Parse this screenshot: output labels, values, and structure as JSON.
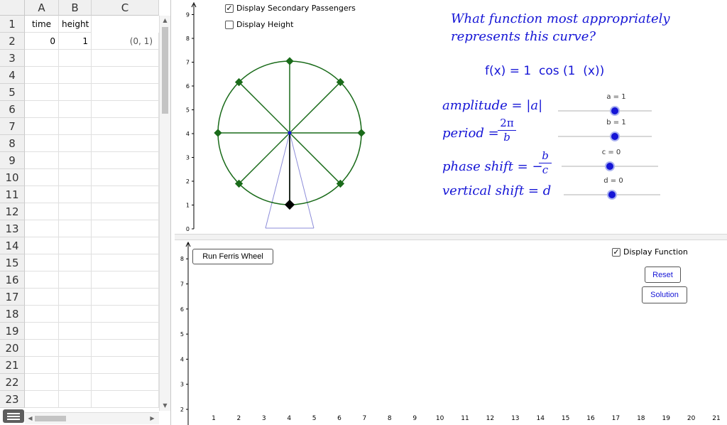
{
  "spreadsheet": {
    "columns": [
      "A",
      "B",
      "C"
    ],
    "rows": [
      "1",
      "2",
      "3",
      "4",
      "5",
      "6",
      "7",
      "8",
      "9",
      "10",
      "11",
      "12",
      "13",
      "14",
      "15",
      "16",
      "17",
      "18",
      "19",
      "20",
      "21",
      "22",
      "23"
    ],
    "cells": {
      "a1": "time",
      "b1": "height",
      "a2": "0",
      "b2": "1",
      "c2": "(0, 1)"
    }
  },
  "top_view": {
    "checkbox_secondary": {
      "label": "Display Secondary Passengers",
      "checked": true
    },
    "checkbox_height": {
      "label": "Display Height",
      "checked": false
    },
    "y_ticks": [
      "0",
      "1",
      "2",
      "3",
      "4",
      "5",
      "6",
      "7",
      "8",
      "9"
    ],
    "question_line1": "What function most appropriately",
    "question_line2": "represents this curve?",
    "function_text": "f(x) = 1  cos (1  (x))",
    "amplitude_text": "amplitude = |a|",
    "period_lhs": "period =",
    "period_num": "2π",
    "period_den": "b",
    "phase_lhs": "phase shift = −",
    "phase_num": "b",
    "phase_den": "c",
    "vertical_text": "vertical shift = d",
    "sliders": [
      {
        "label": "a = 1",
        "value": 1
      },
      {
        "label": "b = 1",
        "value": 1
      },
      {
        "label": "c = 0",
        "value": 0
      },
      {
        "label": "d = 0",
        "value": 0
      }
    ],
    "colors": {
      "wheel": "#1a6b1a",
      "math": "#1515d6",
      "stand": "#8c8cd9"
    }
  },
  "bottom_view": {
    "run_button": "Run Ferris Wheel",
    "checkbox_function": {
      "label": "Display Function",
      "checked": true
    },
    "reset_button": "Reset",
    "solution_button": "Solution",
    "y_ticks": [
      "2",
      "3",
      "4",
      "5",
      "6",
      "7",
      "8"
    ],
    "x_ticks": [
      "1",
      "2",
      "3",
      "4",
      "5",
      "6",
      "7",
      "8",
      "9",
      "10",
      "11",
      "12",
      "13",
      "14",
      "15",
      "16",
      "17",
      "18",
      "19",
      "20",
      "21"
    ]
  }
}
